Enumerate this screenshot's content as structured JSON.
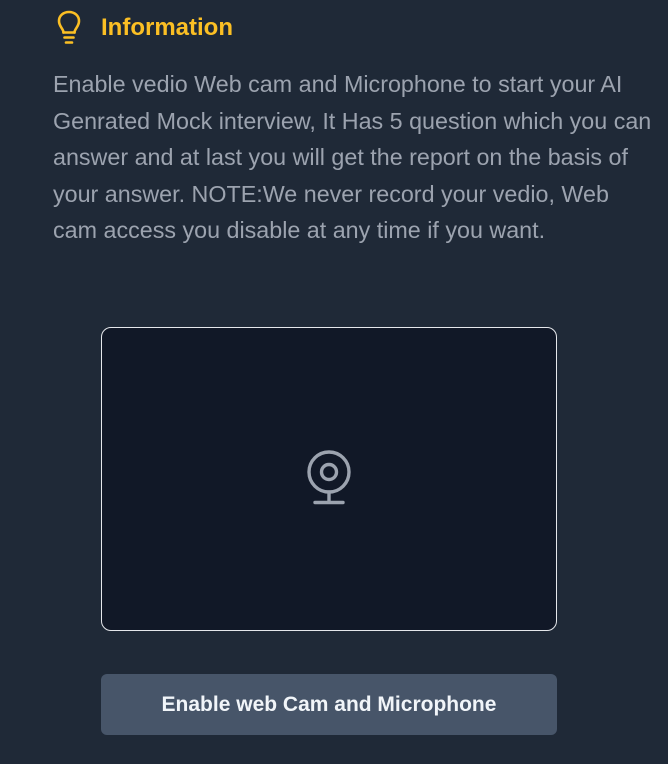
{
  "information": {
    "icon": "lightbulb-icon",
    "title": "Information",
    "title_color": "#fbbf24",
    "body": "Enable vedio Web cam and Microphone to start your AI Genrated Mock interview, It Has 5 question which you can answer and at last you will get the report on the basis of your answer. NOTE:We never record your vedio, Web cam access you disable at any time if you want."
  },
  "webcam_preview": {
    "icon": "webcam-icon"
  },
  "enable_button": {
    "label": "Enable web Cam and Microphone"
  },
  "colors": {
    "background": "#1f2937",
    "preview_background": "#111827",
    "button_background": "#475569"
  }
}
